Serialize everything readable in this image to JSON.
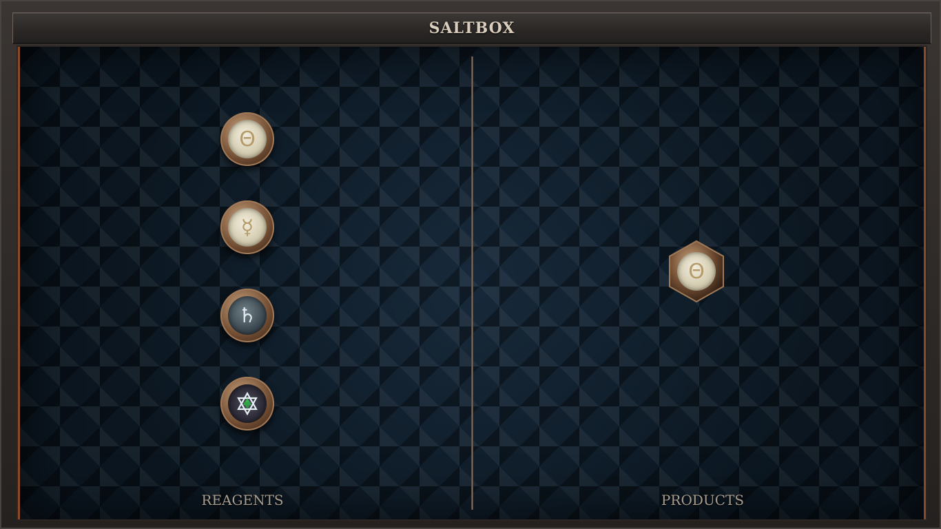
{
  "title": "SALTBOX",
  "panels": {
    "reagents": {
      "label": "REAGENTS",
      "atoms": [
        {
          "symbol": "Θ",
          "element": "salt",
          "icon": "salt-symbol-icon"
        },
        {
          "symbol": "☿",
          "element": "quicksilver",
          "icon": "quicksilver-symbol-icon"
        },
        {
          "symbol": "♄",
          "element": "lead",
          "icon": "lead-symbol-icon"
        },
        {
          "symbol": "",
          "element": "quintessence",
          "icon": "hexagram-icon"
        }
      ]
    },
    "products": {
      "label": "PRODUCTS",
      "atoms": [
        {
          "symbol": "Θ",
          "element": "salt",
          "icon": "salt-symbol-icon"
        }
      ]
    }
  },
  "colors": {
    "frame": "#2a2725",
    "board": "#0c1a24",
    "accent_copper": "#8a4a28",
    "label": "#a89e90",
    "title": "#d9cdbd"
  }
}
